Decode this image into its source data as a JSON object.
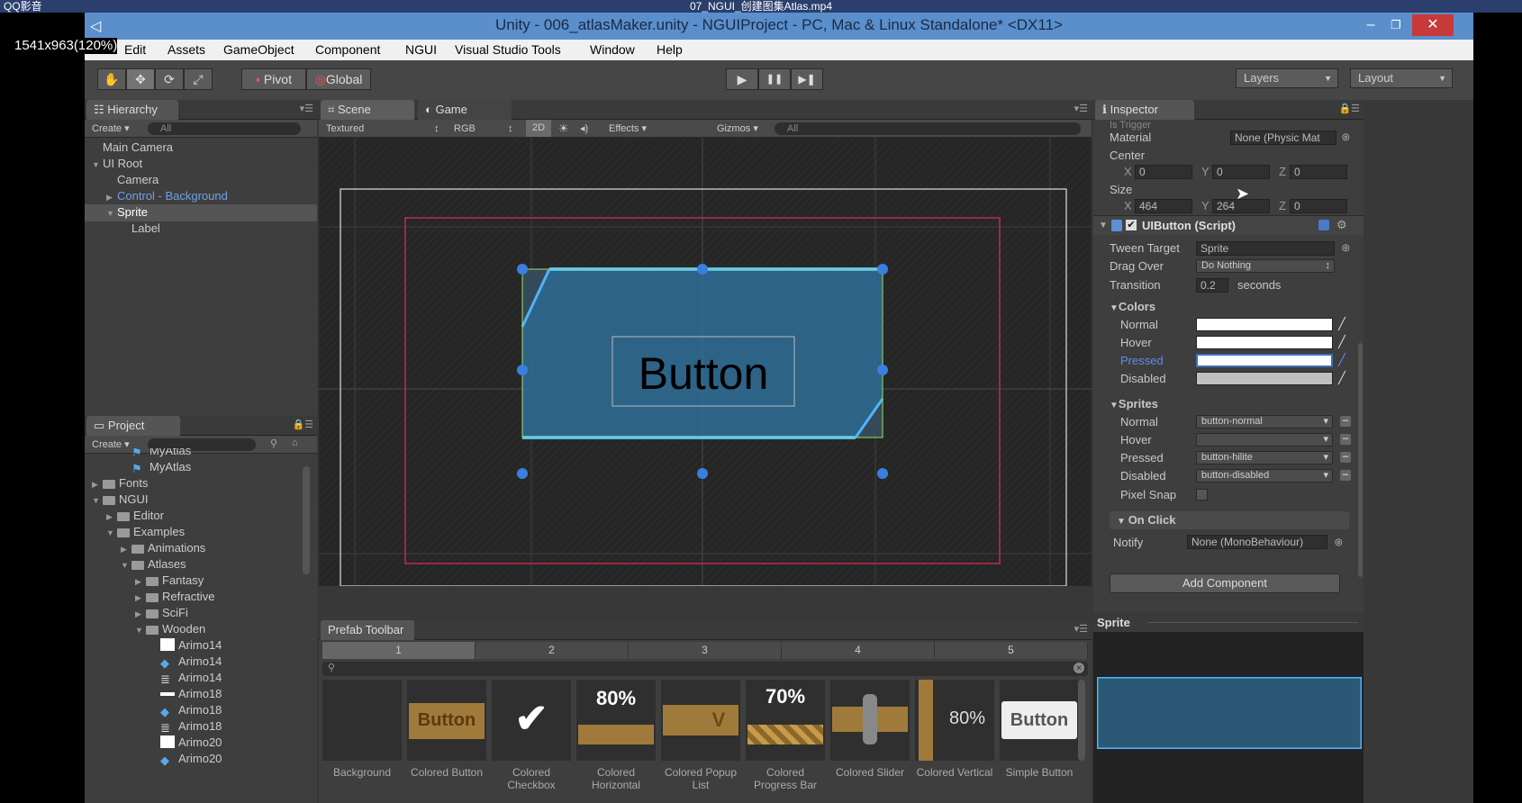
{
  "player": {
    "left_title": "QQ影音",
    "file_title": "07_NGUI_创建图集Atlas.mp4",
    "resolution": "1541x963(120%)"
  },
  "window": {
    "title": "Unity - 006_atlasMaker.unity - NGUIProject - PC, Mac & Linux Standalone* <DX11>",
    "minimize": "–",
    "restore": "❐",
    "close": "✕"
  },
  "menu": [
    "Edit",
    "Assets",
    "GameObject",
    "Component",
    "NGUI",
    "Visual Studio Tools",
    "Window",
    "Help"
  ],
  "toolbar": {
    "pivot": "Pivot",
    "global": "Global",
    "play": "▶",
    "pause": "❚❚",
    "step": "▶❚",
    "layers": "Layers",
    "layout": "Layout"
  },
  "hierarchy": {
    "tab": "Hierarchy",
    "create": "Create",
    "search": "All",
    "items": [
      {
        "label": "Main Camera",
        "indent": 0,
        "arrow": ""
      },
      {
        "label": "UI Root",
        "indent": 0,
        "arrow": "▼"
      },
      {
        "label": "Camera",
        "indent": 1,
        "arrow": ""
      },
      {
        "label": "Control - Background",
        "indent": 1,
        "arrow": "▶",
        "color": "#6fa0e8"
      },
      {
        "label": "Sprite",
        "indent": 1,
        "arrow": "▼",
        "selected": true
      },
      {
        "label": "Label",
        "indent": 2,
        "arrow": ""
      }
    ]
  },
  "scene": {
    "tab_scene": "Scene",
    "tab_game": "Game",
    "textured": "Textured",
    "rgb": "RGB",
    "mode2d": "2D",
    "effects": "Effects",
    "gizmos": "Gizmos",
    "search": "All",
    "button_text": "Button"
  },
  "project": {
    "tab": "Project",
    "create": "Create",
    "items": [
      {
        "label": "MyAtlas",
        "indent": 2,
        "type": "atlas"
      },
      {
        "label": "MyAtlas",
        "indent": 2,
        "type": "atlas"
      },
      {
        "label": "Fonts",
        "indent": 0,
        "type": "folder",
        "arrow": "▶"
      },
      {
        "label": "NGUI",
        "indent": 0,
        "type": "folder",
        "arrow": "▼"
      },
      {
        "label": "Editor",
        "indent": 1,
        "type": "folder",
        "arrow": "▶"
      },
      {
        "label": "Examples",
        "indent": 1,
        "type": "folder",
        "arrow": "▼"
      },
      {
        "label": "Animations",
        "indent": 2,
        "type": "folder",
        "arrow": "▶"
      },
      {
        "label": "Atlases",
        "indent": 2,
        "type": "folder",
        "arrow": "▼"
      },
      {
        "label": "Fantasy",
        "indent": 3,
        "type": "folder",
        "arrow": "▶"
      },
      {
        "label": "Refractive",
        "indent": 3,
        "type": "folder",
        "arrow": "▶"
      },
      {
        "label": "SciFi",
        "indent": 3,
        "type": "folder",
        "arrow": "▶"
      },
      {
        "label": "Wooden",
        "indent": 3,
        "type": "folder",
        "arrow": "▼"
      },
      {
        "label": "Arimo14",
        "indent": 4,
        "type": "white"
      },
      {
        "label": "Arimo14",
        "indent": 4,
        "type": "cube"
      },
      {
        "label": "Arimo14",
        "indent": 4,
        "type": "doc"
      },
      {
        "label": "Arimo18",
        "indent": 4,
        "type": "bar"
      },
      {
        "label": "Arimo18",
        "indent": 4,
        "type": "cube"
      },
      {
        "label": "Arimo18",
        "indent": 4,
        "type": "doc"
      },
      {
        "label": "Arimo20",
        "indent": 4,
        "type": "white"
      },
      {
        "label": "Arimo20",
        "indent": 4,
        "type": "cube"
      }
    ]
  },
  "prefab_toolbar": {
    "tab": "Prefab Toolbar",
    "pages": [
      "1",
      "2",
      "3",
      "4",
      "5"
    ],
    "items": [
      {
        "name": "Background",
        "thumb": ""
      },
      {
        "name": "Colored Button",
        "thumb": "Button"
      },
      {
        "name": "Colored Checkbox",
        "thumb": "✔"
      },
      {
        "name": "Colored Horizontal",
        "thumb": "80%"
      },
      {
        "name": "Colored Popup List",
        "thumb": "V"
      },
      {
        "name": "Colored Progress Bar",
        "thumb": "70%"
      },
      {
        "name": "Colored Slider",
        "thumb": ""
      },
      {
        "name": "Colored Vertical",
        "thumb": "80%"
      },
      {
        "name": "Simple Button",
        "thumb": "Button"
      }
    ]
  },
  "inspector": {
    "tab": "Inspector",
    "is_trigger": "Is Trigger",
    "material_label": "Material",
    "material_value": "None (Physic Mat",
    "center_label": "Center",
    "center": {
      "x": "0",
      "y": "0",
      "z": "0"
    },
    "size_label": "Size",
    "size": {
      "x": "464",
      "y": "264",
      "z": "0"
    },
    "component_title": "UIButton (Script)",
    "tween_target_label": "Tween Target",
    "tween_target": "Sprite",
    "drag_over_label": "Drag Over",
    "drag_over": "Do Nothing",
    "transition_label": "Transition",
    "transition": "0.2",
    "seconds": "seconds",
    "colors_label": "Colors",
    "colors": [
      {
        "label": "Normal",
        "color": "#ffffff"
      },
      {
        "label": "Hover",
        "color": "#ffffff"
      },
      {
        "label": "Pressed",
        "color": "#ffffff",
        "active": true
      },
      {
        "label": "Disabled",
        "color": "#c0c0c0"
      }
    ],
    "sprites_label": "Sprites",
    "sprites": [
      {
        "label": "Normal",
        "value": "button-normal"
      },
      {
        "label": "Hover",
        "value": ""
      },
      {
        "label": "Pressed",
        "value": "button-hilite"
      },
      {
        "label": "Disabled",
        "value": "button-disabled"
      }
    ],
    "pixel_snap": "Pixel Snap",
    "on_click": "On Click",
    "notify_label": "Notify",
    "notify_value": "None (MonoBehaviour)",
    "add_component": "Add Component",
    "preview_title": "Sprite"
  },
  "axis": {
    "x": "X",
    "y": "Y",
    "z": "Z"
  },
  "colors": {
    "title_blue": "#5a8fcc",
    "selection_blue": "#3e6fb8",
    "pressed_label": "#5b8ff0",
    "red_frame": "#c42a4a",
    "sprite_blue": "#2f6f98"
  }
}
